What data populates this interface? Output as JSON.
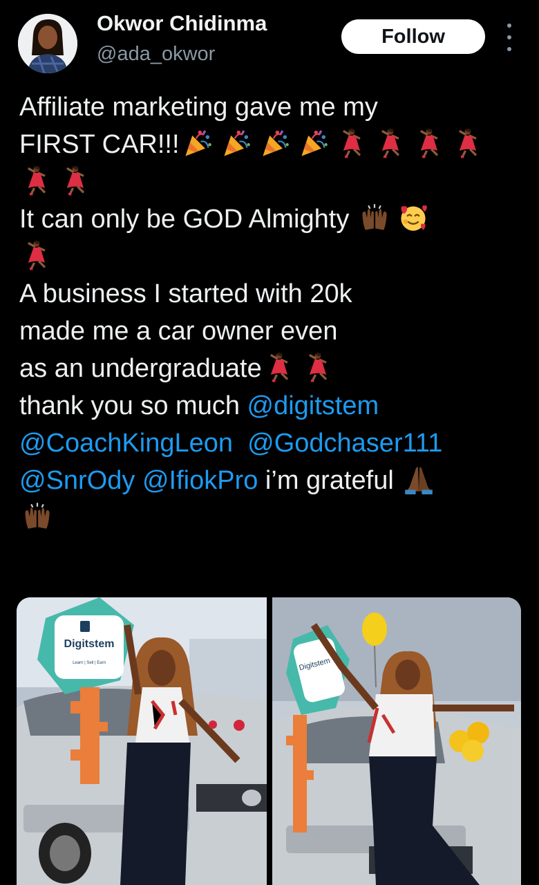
{
  "user": {
    "name": "Okwor Chidinma",
    "handle": "@ada_okwor",
    "follow_label": "Follow"
  },
  "tweet": {
    "l1": "Affiliate marketing gave me my",
    "l2": "FIRST CAR!!!",
    "l4": "It can only be GOD Almighty",
    "l6": "A business I started with 20k",
    "l7": "made me a car owner even",
    "l8": "as an undergraduate",
    "l9_text": "thank you so much ",
    "m1": "@digitstem",
    "m2": "@CoachKingLeon",
    "m3": "@Godchaser111",
    "m4": "@SnrOdy",
    "m5": "@IfiokPro",
    "l11_text": " i’m grateful"
  },
  "media": {
    "left_brand": "Digitstem",
    "left_tagline": "Learn | Sell | Earn",
    "right_brand": "Digitstem"
  },
  "colors": {
    "background": "#000000",
    "mention": "#1d9bf0",
    "handle": "#8b98a5"
  },
  "icons": [
    "party-popper-icon",
    "dancer-icon",
    "raising-hands-icon",
    "smiling-face-with-hearts-icon",
    "folded-hands-icon",
    "more-options-icon"
  ]
}
